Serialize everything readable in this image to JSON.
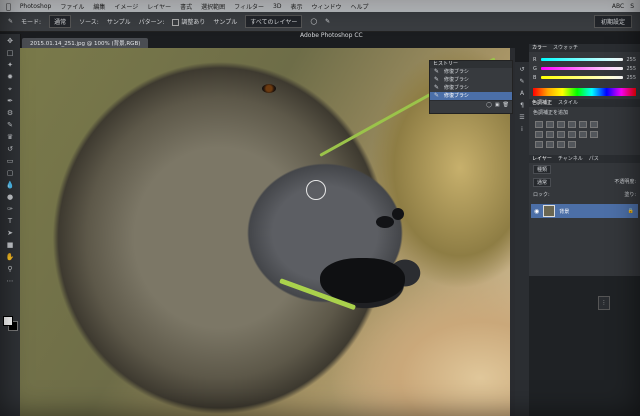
{
  "menubar": {
    "app": "Photoshop",
    "items": [
      "ファイル",
      "編集",
      "イメージ",
      "レイヤー",
      "書式",
      "選択範囲",
      "フィルター",
      "3D",
      "表示",
      "ウィンドウ",
      "ヘルプ"
    ],
    "status": [
      "ABC",
      "S"
    ]
  },
  "options": {
    "mode_label": "モード:",
    "mode_value": "通常",
    "source_label": "ソース:",
    "sample_label": "サンプル",
    "pattern_label": "パターン:",
    "aligned_label": "調整あり",
    "sample2_label": "サンプル",
    "layers_value": "すべてのレイヤー",
    "workspace": "初期設定"
  },
  "app_title": "Adobe Photoshop CC",
  "doc_tab": "2015.01.14_251.jpg @ 100% (背景,RGB)",
  "history": {
    "title": "ヒストリー",
    "items": [
      "修復ブラシ",
      "修復ブラシ",
      "修復ブラシ",
      "修復ブラシ"
    ],
    "active_index": 3
  },
  "color_panel": {
    "tabs": [
      "カラー",
      "スウォッチ"
    ],
    "channels": [
      {
        "label": "R",
        "value": "255"
      },
      {
        "label": "G",
        "value": "255"
      },
      {
        "label": "B",
        "value": "255"
      }
    ]
  },
  "adjustments": {
    "tabs": [
      "色調補正",
      "スタイル"
    ],
    "add_label": "色調補正を追加"
  },
  "layers": {
    "tabs": [
      "レイヤー",
      "チャンネル",
      "パス"
    ],
    "kind_label": "種類",
    "blend_mode": "通常",
    "opacity_label": "不透明度:",
    "lock_label": "ロック:",
    "fill_label": "塗り:",
    "layer_name": "背景"
  },
  "colors": {
    "accent": "#4b6fa8",
    "panel_bg": "#34373b",
    "grass": "#9bc34a"
  }
}
